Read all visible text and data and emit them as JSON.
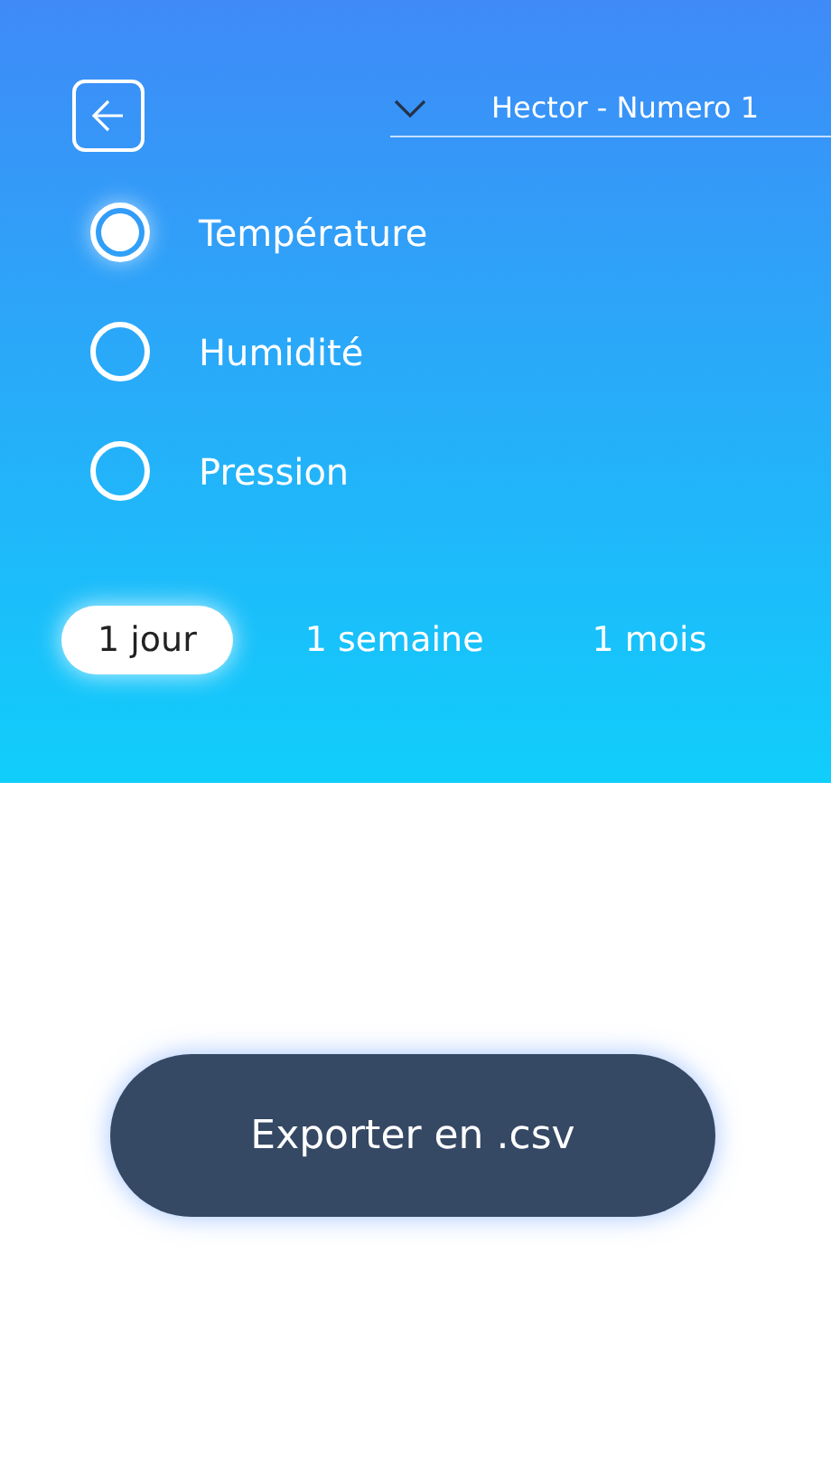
{
  "device_selector": {
    "value": "Hector - Numero 1"
  },
  "measures": [
    {
      "label": "Température",
      "selected": true
    },
    {
      "label": "Humidité",
      "selected": false
    },
    {
      "label": "Pression",
      "selected": false
    }
  ],
  "periods": [
    {
      "label": "1 jour",
      "selected": true
    },
    {
      "label": "1 semaine",
      "selected": false
    },
    {
      "label": "1 mois",
      "selected": false
    }
  ],
  "export_button": "Exporter en .csv"
}
